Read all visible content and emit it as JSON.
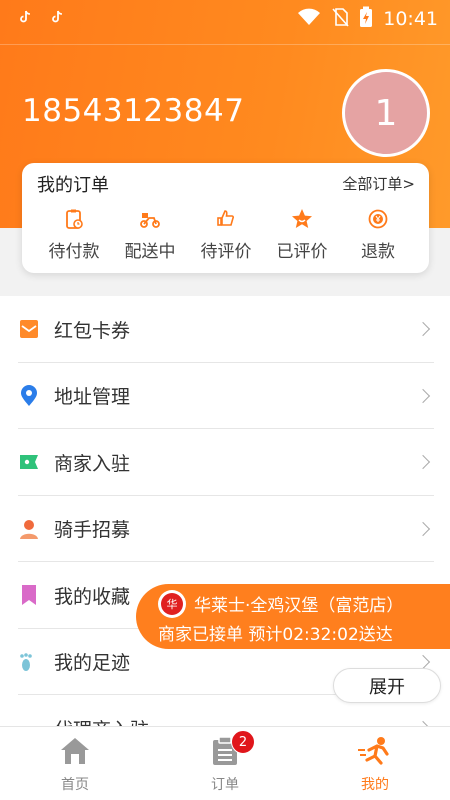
{
  "status_bar": {
    "time": "10:41"
  },
  "profile": {
    "phone": "18543123847",
    "avatar_text": "1"
  },
  "orders": {
    "title": "我的订单",
    "all_label": "全部订单>",
    "items": [
      {
        "label": "待付款",
        "icon": "pending-payment-icon"
      },
      {
        "label": "配送中",
        "icon": "delivery-scooter-icon"
      },
      {
        "label": "待评价",
        "icon": "thumb-up-icon"
      },
      {
        "label": "已评价",
        "icon": "star-icon"
      },
      {
        "label": "退款",
        "icon": "refund-icon"
      }
    ]
  },
  "menu": [
    {
      "label": "红包卡券",
      "icon": "coupon-icon"
    },
    {
      "label": "地址管理",
      "icon": "location-pin-icon"
    },
    {
      "label": "商家入驻",
      "icon": "merchant-icon"
    },
    {
      "label": "骑手招募",
      "icon": "rider-icon"
    },
    {
      "label": "我的收藏",
      "icon": "bookmark-icon"
    },
    {
      "label": "我的足迹",
      "icon": "footprint-icon"
    },
    {
      "label": "代理商入驻",
      "icon": "agent-icon"
    }
  ],
  "notification": {
    "line1": "华莱士·全鸡汉堡（富范店）",
    "line2": "商家已接单 预计02:32:02送达",
    "logo_text": "华"
  },
  "expand_label": "展开",
  "tabs": [
    {
      "label": "首页",
      "icon": "home-icon"
    },
    {
      "label": "订单",
      "icon": "order-list-icon",
      "badge": "2"
    },
    {
      "label": "我的",
      "icon": "runner-icon"
    }
  ],
  "colors": {
    "accent": "#ff7a1a",
    "badge": "#e0161b"
  }
}
